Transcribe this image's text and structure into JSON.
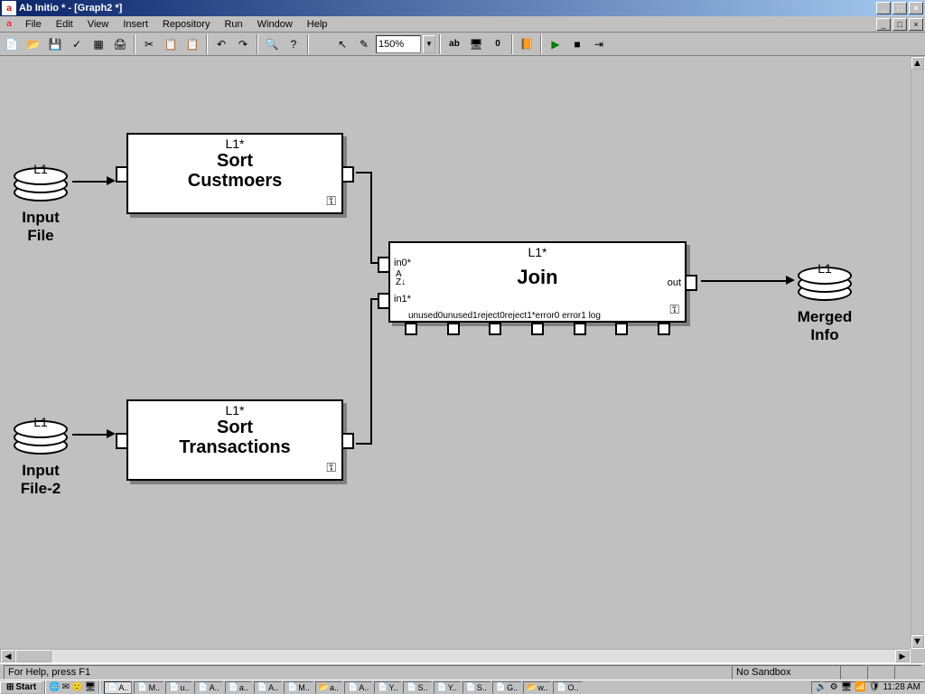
{
  "window": {
    "title": "Ab Initio * - [Graph2 *]"
  },
  "menu": {
    "items": [
      "File",
      "Edit",
      "View",
      "Insert",
      "Repository",
      "Run",
      "Window",
      "Help"
    ]
  },
  "toolbar": {
    "zoom": "150%"
  },
  "diagram": {
    "input1": {
      "tag": "L1",
      "caption_l1": "Input",
      "caption_l2": "File"
    },
    "input2": {
      "tag": "L1",
      "caption_l1": "Input",
      "caption_l2": "File-2"
    },
    "sort1": {
      "header": "L1*",
      "title_l1": "Sort",
      "title_l2": "Custmoers"
    },
    "sort2": {
      "header": "L1*",
      "title_l1": "Sort",
      "title_l2": "Transactions"
    },
    "join": {
      "header": "L1*",
      "title": "Join",
      "in0": "in0*",
      "in1": "in1*",
      "out": "out",
      "bottom_ports": "unused0unused1reject0reject1*error0 error1   log"
    },
    "output": {
      "tag": "L1",
      "caption_l1": "Merged",
      "caption_l2": "Info"
    }
  },
  "status": {
    "help": "For Help, press F1",
    "sandbox": "No Sandbox"
  },
  "taskbar": {
    "start": "Start",
    "items": [
      "A..",
      "M..",
      "u..",
      "A..",
      "a..",
      "A..",
      "M..",
      "a..",
      "A..",
      "Y..",
      "S..",
      "Y..",
      "S..",
      "G..",
      "w..",
      "O.."
    ],
    "clock": "11:28 AM"
  }
}
